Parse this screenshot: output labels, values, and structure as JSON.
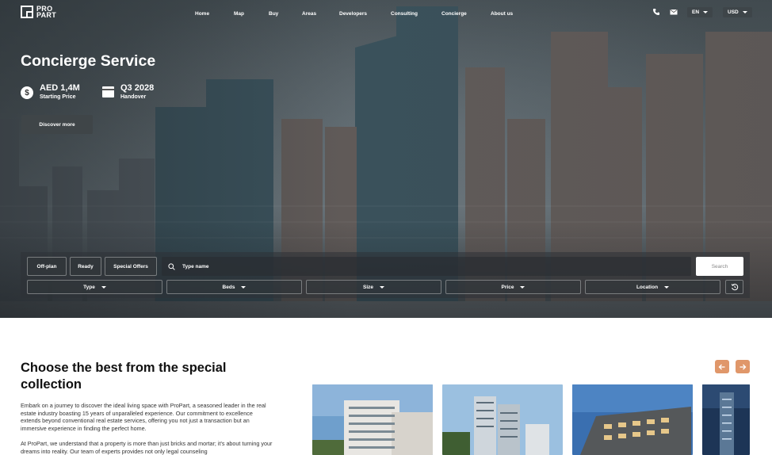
{
  "brand": {
    "line1": "PRO",
    "line2": "PART"
  },
  "nav": {
    "items": [
      "Home",
      "Map",
      "Buy",
      "Areas",
      "Developers",
      "Consulting",
      "Concierge",
      "About us"
    ]
  },
  "header": {
    "phone_icon": "phone-icon",
    "mail_icon": "mail-icon",
    "language": "EN",
    "currency": "USD"
  },
  "hero": {
    "title": "Concierge Service",
    "price": {
      "value": "AED 1,4M",
      "label": "Starting Price",
      "icon": "dollar-coin-icon"
    },
    "handover": {
      "value": "Q3 2028",
      "label": "Handover",
      "icon": "calendar-icon"
    },
    "cta": "Discover more"
  },
  "search": {
    "chips": [
      "Off-plan",
      "Ready",
      "Special Offers"
    ],
    "placeholder": "Type name",
    "button": "Search",
    "filters": [
      "Type",
      "Beds",
      "Size",
      "Price",
      "Location"
    ]
  },
  "collection": {
    "title": "Choose the best from the special collection",
    "paragraph1": "Embark on a journey to discover the ideal living space with ProPart, a seasoned leader in the real estate industry boasting 15 years of unparalleled experience. Our commitment to excellence extends beyond conventional real estate services, offering you not just a transaction but an immersive experience in finding the perfect home.",
    "paragraph2": "At ProPart, we understand that a property is more than just bricks and mortar; it's about turning your dreams into reality. Our team of experts provides not only legal counseling",
    "prev_icon": "arrow-left-icon",
    "next_icon": "arrow-right-icon"
  },
  "colors": {
    "accent": "#e0976a",
    "panel": "#3f4548",
    "white": "#ffffff"
  }
}
